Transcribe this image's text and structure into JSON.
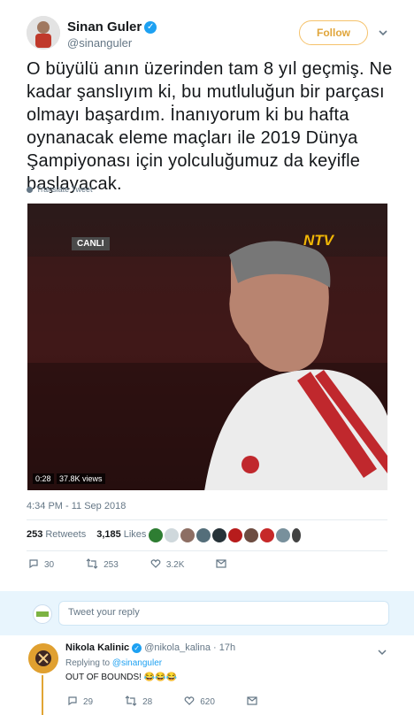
{
  "author": {
    "name": "Sinan Guler",
    "handle": "@sinanguler",
    "follow_label": "Follow"
  },
  "tweet": {
    "lines": [
      "O büyülü anın üzerinden tam 8 yıl geçmiş. Ne",
      "kadar şanslıyım ki, bu mutluluğun bir parçası",
      "olmayı başardım. İnanıyorum ki bu hafta",
      "oynanacak eleme maçları ile 2019 Dünya",
      "Şampiyonası için yolculuğumuz da keyifle",
      "başlayacak."
    ],
    "translate_label": "Translate Tweet",
    "timestamp": "4:34 PM - 11 Sep 2018"
  },
  "video": {
    "live_label": "CANLI",
    "channel_logo": "NTV",
    "duration": "0:28",
    "views": "37.8K views"
  },
  "stats": {
    "retweets_count": "253",
    "retweets_label": "Retweets",
    "likes_count": "3,185",
    "likes_label": "Likes"
  },
  "actions": {
    "replies": "30",
    "retweets": "253",
    "likes": "3.2K"
  },
  "reply_box": {
    "placeholder": "Tweet your reply"
  },
  "reply": {
    "name": "Nikola Kalinic",
    "handle": "@nikola_kalina",
    "time": "· 17h",
    "replying_prefix": "Replying to",
    "replying_to": "@sinanguler",
    "text": "OUT OF BOUNDS! 😂😂😂",
    "replies": "29",
    "retweets": "28",
    "likes": "620"
  },
  "colors": {
    "accent": "#1da1f2",
    "follow_border": "#f5c26b",
    "thread_line": "#e1a534"
  }
}
